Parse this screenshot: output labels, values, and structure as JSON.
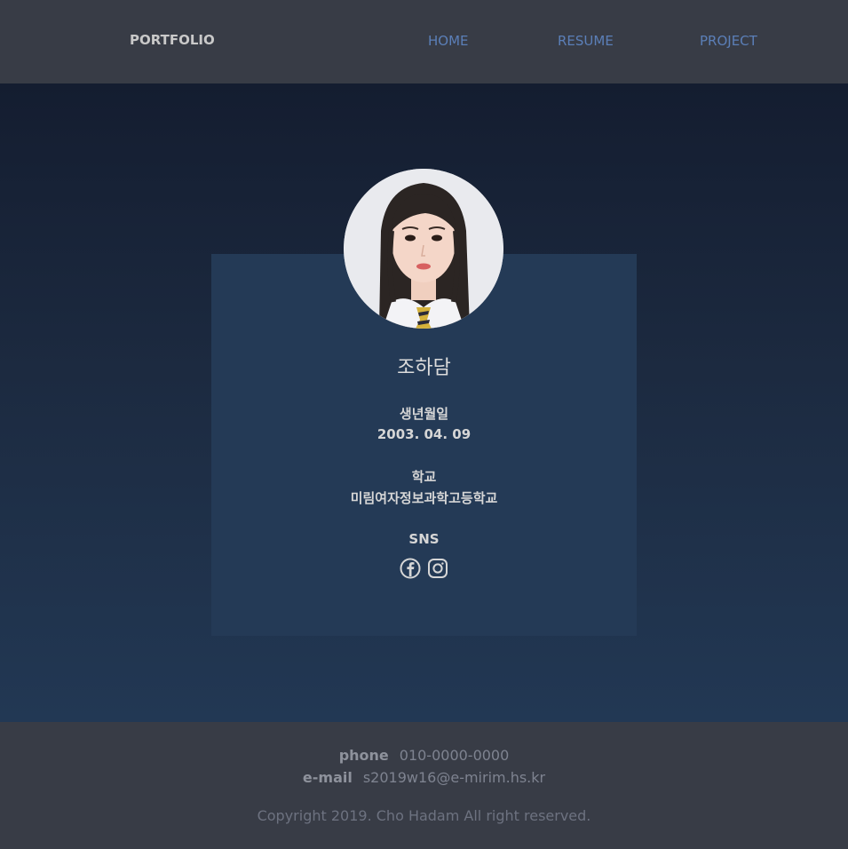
{
  "nav": {
    "brand": "PORTFOLIO",
    "links": [
      "HOME",
      "RESUME",
      "PROJECT"
    ]
  },
  "profile": {
    "name": "조하담",
    "birth_label": "생년월일",
    "birth_value": "2003. 04. 09",
    "school_label": "학교",
    "school_value": "미림여자정보과학고등학교",
    "sns_label": "SNS",
    "sns_icons": [
      "facebook-icon",
      "instagram-icon"
    ]
  },
  "footer": {
    "phone_label": "phone",
    "phone_value": "010-0000-0000",
    "email_label": "e-mail",
    "email_value": "s2019w16@e-mirim.hs.kr",
    "copyright": "Copyright 2019. Cho Hadam All right reserved."
  },
  "colors": {
    "nav_bg": "#383c46",
    "nav_link": "#5b7fb8",
    "hero_top": "#141d30",
    "hero_bottom": "#223854",
    "card_bg": "#243a56"
  }
}
